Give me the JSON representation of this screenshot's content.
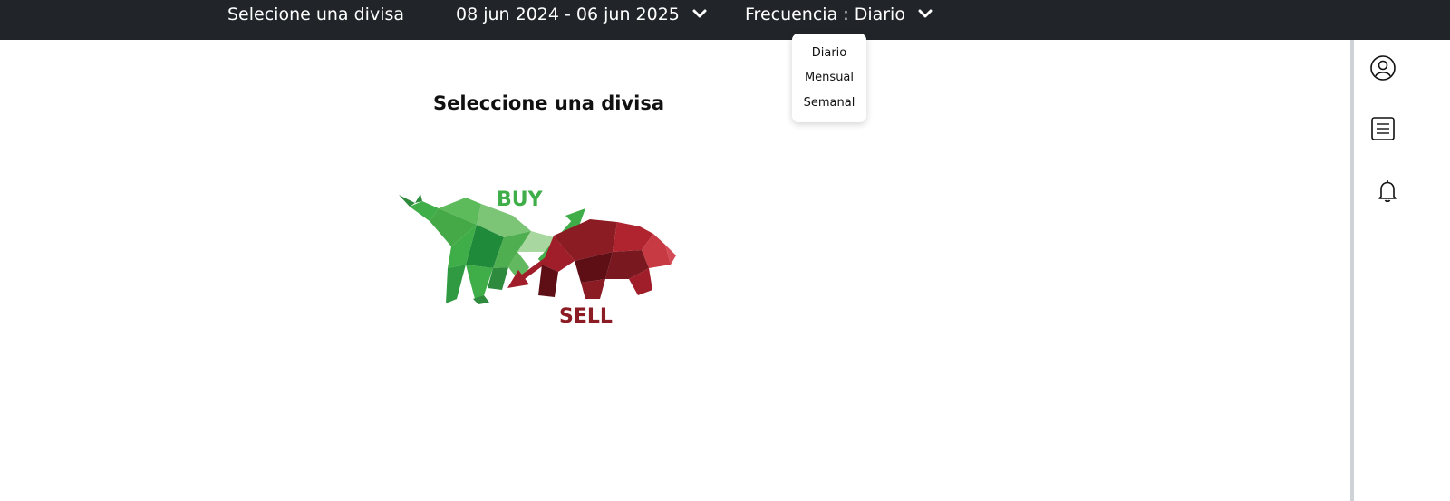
{
  "topbar": {
    "currency_label": "Selecione una divisa",
    "date_range_label": "08 jun 2024 - 06 jun 2025",
    "frequency_label": "Frecuencia : Diario",
    "chevron_icon": "chevron-down-icon"
  },
  "frequency_dropdown": {
    "options": [
      "Diario",
      "Mensual",
      "Semanal"
    ]
  },
  "main": {
    "title": "Seleccione una divisa",
    "illustration": {
      "buy_text": "BUY",
      "sell_text": "SELL",
      "buy_color": "#3fae49",
      "sell_color": "#8c1c24"
    }
  },
  "right_rail": {
    "icons": [
      "user-circle-icon",
      "list-icon",
      "bell-icon"
    ]
  },
  "colors": {
    "topbar_bg": "#212529",
    "topbar_text": "#ffffff",
    "rail_border": "#cfd3d8"
  }
}
